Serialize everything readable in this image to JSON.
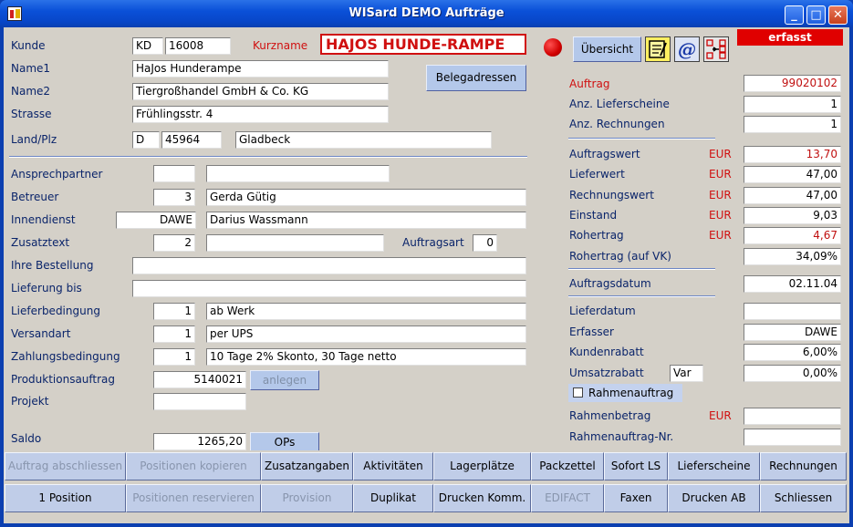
{
  "window": {
    "title": "WISard DEMO Aufträge"
  },
  "colors": {
    "titlebar": "#0a50d8",
    "accent_red": "#d01010",
    "status_bg": "#e00000"
  },
  "titlebar_buttons": [
    "minimize-icon",
    "maximize-icon",
    "close-icon"
  ],
  "header": {
    "kunde_label": "Kunde",
    "kunde_prefix": "KD",
    "kunde_nr": "16008",
    "kurzname_label": "Kurzname",
    "kurzname": "HAJOS HUNDE-RAMPE",
    "name1_label": "Name1",
    "name1": "HaJos Hunderampe",
    "name2_label": "Name2",
    "name2": "Tiergroßhandel GmbH & Co. KG",
    "strasse_label": "Strasse",
    "strasse": "Frühlingsstr. 4",
    "land_label": "Land/Plz",
    "land": "D",
    "plz": "45964",
    "ort": "Gladbeck",
    "belegadressen_button": "Belegadressen"
  },
  "left": {
    "ansprechpartner_label": "Ansprechpartner",
    "ansprechpartner_code": "",
    "ansprechpartner": "",
    "betreuer_label": "Betreuer",
    "betreuer_code": "3",
    "betreuer": "Gerda Gütig",
    "innendienst_label": "Innendienst",
    "innendienst_code": "DAWE",
    "innendienst": "Darius Wassmann",
    "zusatztext_label": "Zusatztext",
    "zusatztext_code": "2",
    "zusatztext": "",
    "auftragsart_label": "Auftragsart",
    "auftragsart": "0",
    "bestellung_label": "Ihre Bestellung",
    "bestellung": "",
    "lieferung_bis_label": "Lieferung bis",
    "lieferung_bis": "",
    "lieferbedingung_label": "Lieferbedingung",
    "lieferbedingung_code": "1",
    "lieferbedingung": "ab Werk",
    "versandart_label": "Versandart",
    "versandart_code": "1",
    "versandart": "per UPS",
    "zahlung_label": "Zahlungsbedingung",
    "zahlung_code": "1",
    "zahlung": "10 Tage 2% Skonto, 30 Tage netto",
    "produktion_label": "Produktionsauftrag",
    "produktion": "5140021",
    "anlegen_button": "anlegen",
    "projekt_label": "Projekt",
    "projekt": "",
    "saldo_label": "Saldo",
    "saldo": "1265,20",
    "ops_button": "OPs"
  },
  "right": {
    "status": "erfasst",
    "uebersicht_button": "Übersicht",
    "icons": [
      "note-icon",
      "at-icon",
      "tree-icon"
    ],
    "auftrag_label": "Auftrag",
    "auftrag": "99020102",
    "lieferscheine_label": "Anz. Lieferscheine",
    "lieferscheine": "1",
    "rechnungen_label": "Anz. Rechnungen",
    "rechnungen": "1",
    "currency": "EUR",
    "auftragswert_label": "Auftragswert",
    "auftragswert": "13,70",
    "lieferwert_label": "Lieferwert",
    "lieferwert": "47,00",
    "rechnungswert_label": "Rechnungswert",
    "rechnungswert": "47,00",
    "einstand_label": "Einstand",
    "einstand": "9,03",
    "rohertrag_label": "Rohertrag",
    "rohertrag": "4,67",
    "rohertrag_vk_label": "Rohertrag (auf VK)",
    "rohertrag_vk": "34,09%",
    "auftragsdatum_label": "Auftragsdatum",
    "auftragsdatum": "02.11.04",
    "lieferdatum_label": "Lieferdatum",
    "lieferdatum": "",
    "erfasser_label": "Erfasser",
    "erfasser": "DAWE",
    "kundenrabatt_label": "Kundenrabatt",
    "kundenrabatt": "6,00%",
    "umsatzrabatt_label": "Umsatzrabatt",
    "umsatzrabatt_type": "Var",
    "umsatzrabatt": "0,00%",
    "rahmenauftrag_label": "Rahmenauftrag",
    "rahmenbetrag_label": "Rahmenbetrag",
    "rahmenbetrag": "",
    "rahmennr_label": "Rahmenauftrag-Nr.",
    "rahmennr": ""
  },
  "buttons_row1": [
    "Auftrag abschliessen",
    "Positionen kopieren",
    "Zusatzangaben",
    "Aktivitäten",
    "Lagerplätze",
    "Packzettel",
    "Sofort LS",
    "Lieferscheine",
    "Rechnungen"
  ],
  "buttons_row2": [
    "1 Position",
    "Positionen reservieren",
    "Provision",
    "Duplikat",
    "Drucken Komm.",
    "EDIFACT",
    "Faxen",
    "Drucken AB",
    "Schliessen"
  ]
}
